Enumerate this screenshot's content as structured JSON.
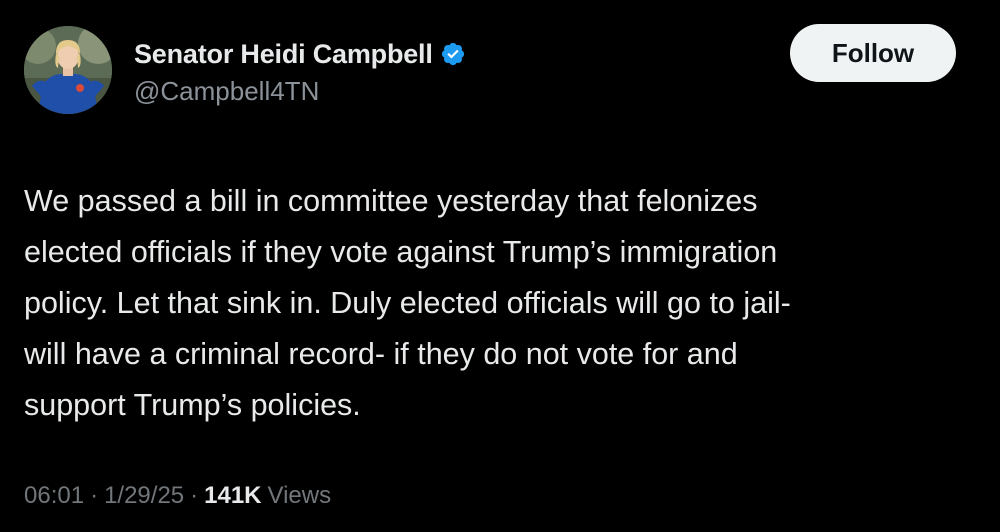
{
  "post": {
    "author": {
      "display_name": "Senator Heidi Campbell",
      "handle": "@Campbell4TN",
      "verified": true,
      "avatar_icon": "user-avatar-photo"
    },
    "follow_button_label": "Follow",
    "text_lines": [
      "We passed a bill in committee yesterday that felonizes",
      "elected officials if they vote against Trump’s immigration",
      "policy. Let that sink in. Duly elected officials will go to jail-",
      "will have a criminal record- if they do not vote for and",
      "support Trump’s policies."
    ],
    "meta": {
      "time": "06:01",
      "separator": "·",
      "date": "1/29/25",
      "views_count": "141K",
      "views_label": "Views"
    }
  },
  "colors": {
    "background": "#000000",
    "text_primary": "#e7e9ea",
    "text_secondary": "#71767b",
    "verified_blue": "#1d9bf0",
    "button_bg": "#eff3f4"
  }
}
